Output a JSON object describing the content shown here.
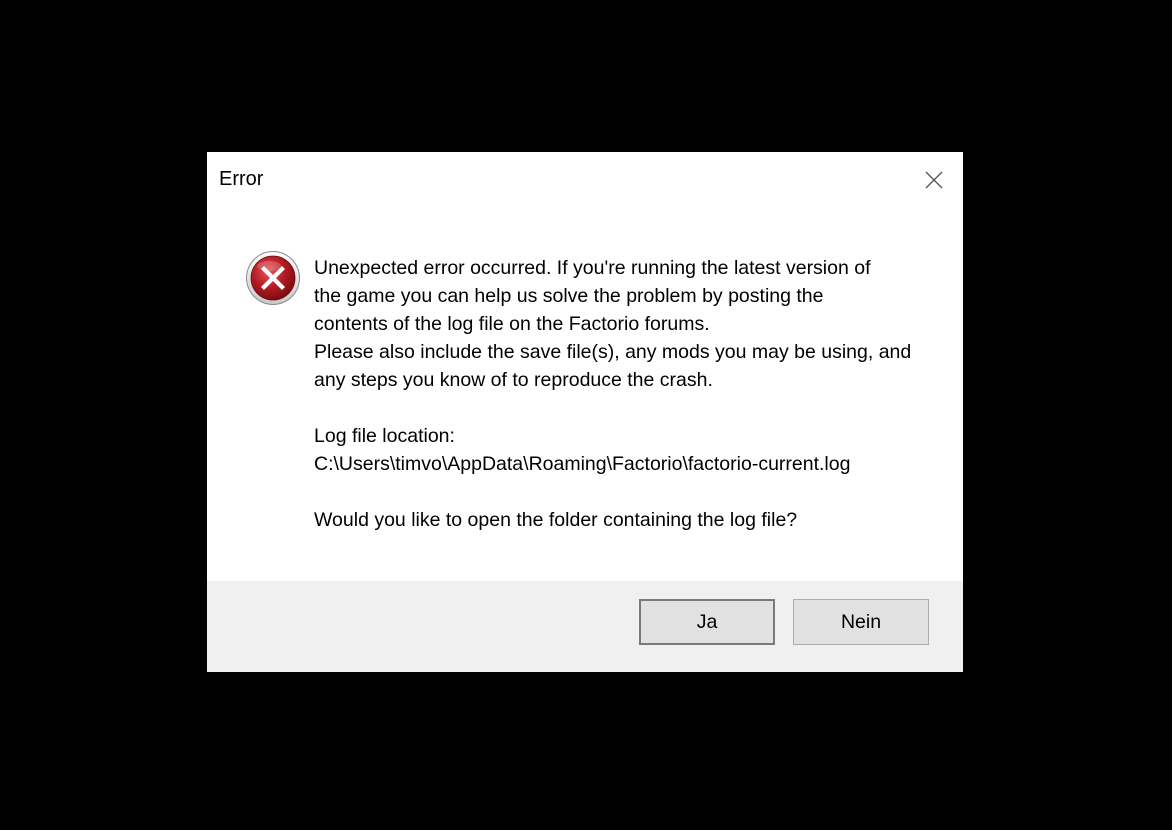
{
  "dialog": {
    "title": "Error",
    "icon": "error-icon",
    "message": {
      "line1": "Unexpected error occurred. If you're running the latest version of",
      "line2": "the game you can help us solve the problem by posting the",
      "line3": "contents of the log file on the Factorio forums.",
      "line4": "Please also include the save file(s), any mods you may be using, and",
      "line5": "any steps you know of to reproduce the crash.",
      "log_label": "Log file location:",
      "log_path": "C:\\Users\\timvo\\AppData\\Roaming\\Factorio\\factorio-current.log",
      "question": "Would you like to open the folder containing the log file?"
    },
    "buttons": {
      "yes_label": "Ja",
      "no_label": "Nein"
    }
  },
  "colors": {
    "backdrop": "#000000",
    "dialog_bg": "#ffffff",
    "footer_bg": "#f0f0f0",
    "button_bg": "#e1e1e1",
    "error_red": "#c0282d"
  }
}
